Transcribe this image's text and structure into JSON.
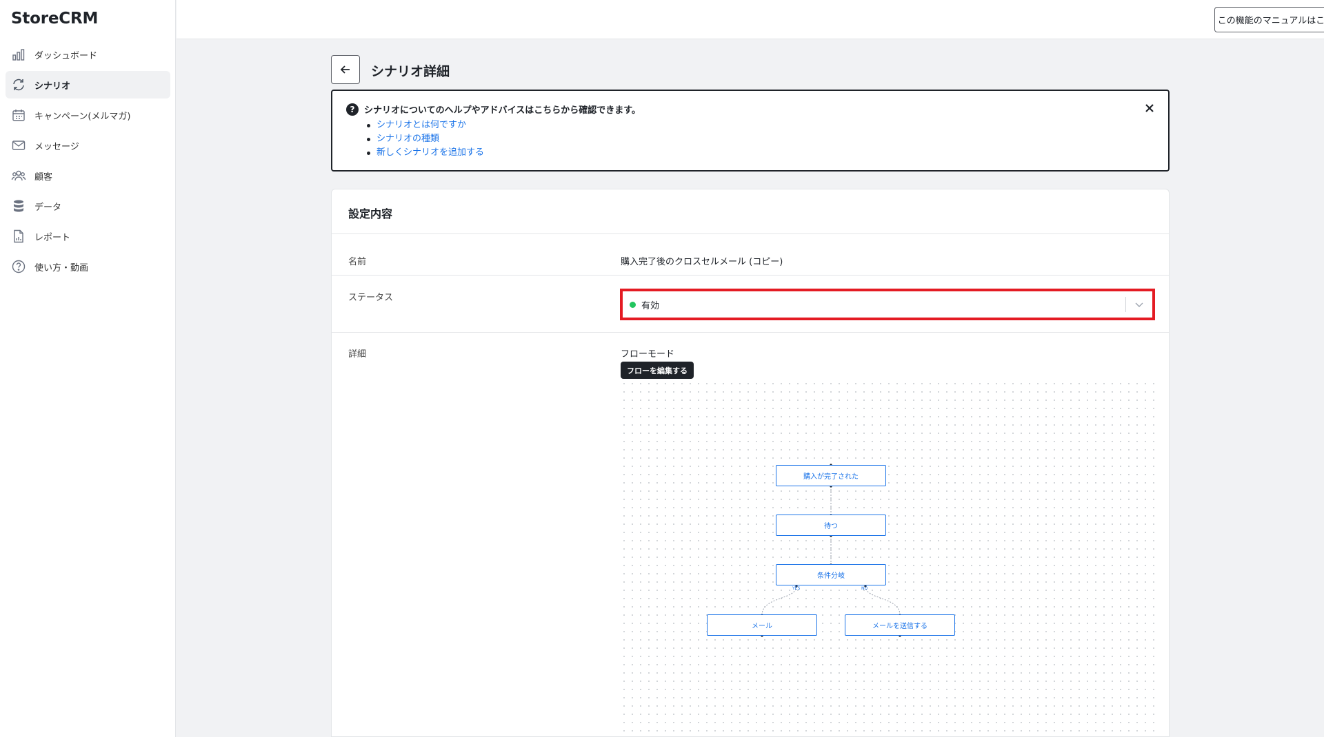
{
  "app": {
    "logo": "StoreCRM"
  },
  "sidebar": {
    "items": [
      {
        "label": "ダッシュボード",
        "icon": "bar-chart-icon"
      },
      {
        "label": "シナリオ",
        "icon": "refresh-icon",
        "active": true
      },
      {
        "label": "キャンペーン(メルマガ)",
        "icon": "calendar-icon"
      },
      {
        "label": "メッセージ",
        "icon": "mail-icon"
      },
      {
        "label": "顧客",
        "icon": "users-icon"
      },
      {
        "label": "データ",
        "icon": "database-icon"
      },
      {
        "label": "レポート",
        "icon": "report-icon"
      },
      {
        "label": "使い方・動画",
        "icon": "help-circle-icon"
      }
    ]
  },
  "header": {
    "manual_button": "この機能のマニュアルはこちら"
  },
  "page": {
    "title": "シナリオ詳細"
  },
  "help": {
    "title": "シナリオについてのヘルプやアドバイスはこちらから確認できます。",
    "links": [
      "シナリオとは何ですか",
      "シナリオの種類",
      "新しくシナリオを追加する"
    ]
  },
  "settings": {
    "title": "設定内容",
    "name_label": "名前",
    "name_value": "購入完了後のクロスセルメール (コピー)",
    "status_label": "ステータス",
    "status_value": "有効",
    "status_color": "#22c55e",
    "detail_label": "詳細",
    "detail_mode": "フローモード",
    "edit_flow_button": "フローを編集する"
  },
  "flow": {
    "nodes": [
      "購入が完了された",
      "待つ",
      "条件分岐",
      "メール",
      "メールを送信する"
    ],
    "branch_yes": "YES",
    "branch_no": "NO"
  },
  "colors": {
    "accent": "#1a73e8",
    "highlight": "#e41b23",
    "dark": "#1f2329"
  }
}
